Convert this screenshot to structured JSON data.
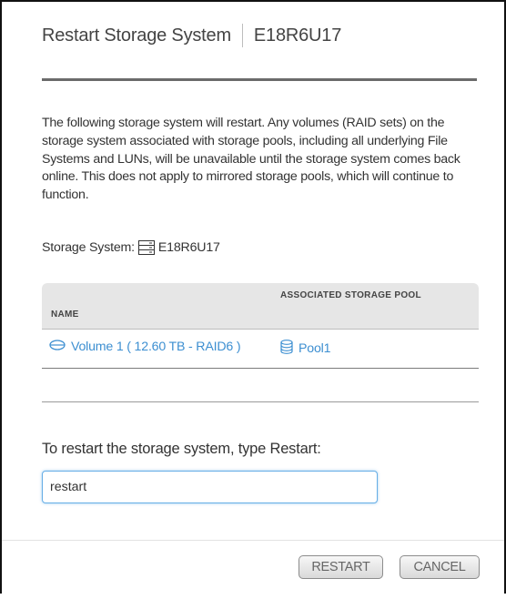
{
  "dialog": {
    "title": "Restart Storage System",
    "system_id": "E18R6U17",
    "description": "The following storage system will restart. Any volumes (RAID sets) on the storage system associated with storage pools, including all underlying File Systems and LUNs, will be unavailable until the storage system comes back online. This does not apply to mirrored storage pools, which will continue to function.",
    "system_label": "Storage System:",
    "system_value": "E18R6U17",
    "system_icon": "server-icon"
  },
  "table": {
    "headers": {
      "name": "NAME",
      "pool": "ASSOCIATED STORAGE POOL"
    },
    "rows": [
      {
        "volume": "Volume 1 ( 12.60 TB - RAID6 )",
        "volume_icon": "volume-icon",
        "pool": "Pool1",
        "pool_icon": "database-icon"
      }
    ]
  },
  "confirm": {
    "prompt": "To restart the storage system, type Restart:",
    "value": "restart"
  },
  "buttons": {
    "restart": "RESTART",
    "cancel": "CANCEL"
  },
  "colors": {
    "link": "#3d8fd1",
    "input_focus": "#66aee6",
    "header_rule": "#6b6b6b",
    "table_header_bg": "#e6e6e6"
  }
}
